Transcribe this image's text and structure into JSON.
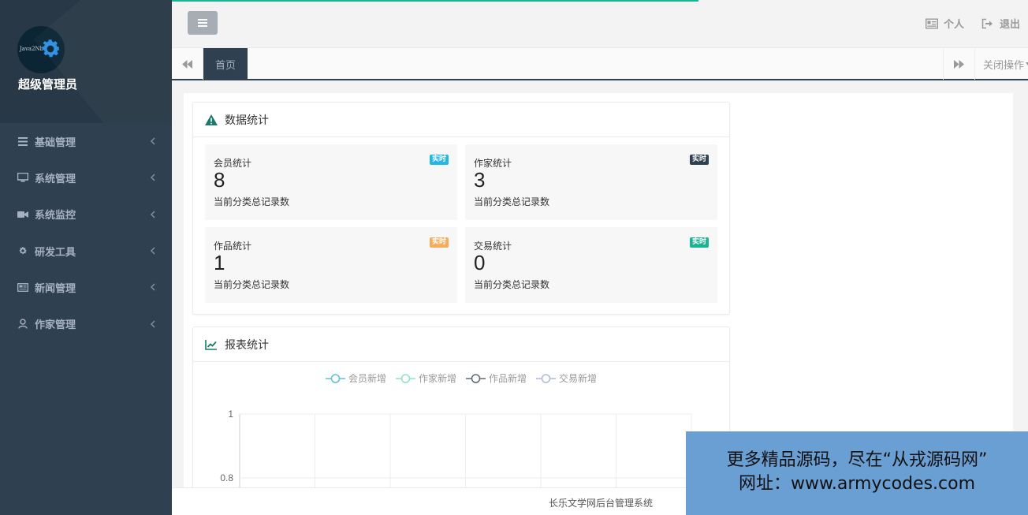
{
  "sidebar": {
    "avatar_text": "Java2Nb",
    "user_name": "超级管理员",
    "items": [
      {
        "label": "基础管理",
        "icon": "list-icon"
      },
      {
        "label": "系统管理",
        "icon": "monitor-icon"
      },
      {
        "label": "系统监控",
        "icon": "video-camera-icon"
      },
      {
        "label": "研发工具",
        "icon": "gear-icon"
      },
      {
        "label": "新闻管理",
        "icon": "newspaper-icon"
      },
      {
        "label": "作家管理",
        "icon": "user-icon"
      }
    ]
  },
  "header": {
    "personal_label": "个人",
    "logout_label": "退出"
  },
  "tabs": {
    "home_label": "首页",
    "close_ops_label": "关闭操作"
  },
  "stats_panel": {
    "title": "数据统计",
    "cards": [
      {
        "title": "会员统计",
        "badge": "实时",
        "badge_color": "#23b7e5",
        "value": "8",
        "desc": "当前分类总记录数"
      },
      {
        "title": "作家统计",
        "badge": "实时",
        "badge_color": "#2f4050",
        "value": "3",
        "desc": "当前分类总记录数"
      },
      {
        "title": "作品统计",
        "badge": "实时",
        "badge_color": "#f8ac59",
        "value": "1",
        "desc": "当前分类总记录数"
      },
      {
        "title": "交易统计",
        "badge": "实时",
        "badge_color": "#1ab394",
        "value": "0",
        "desc": "当前分类总记录数"
      }
    ]
  },
  "report_panel": {
    "title": "报表统计"
  },
  "chart_data": {
    "type": "line",
    "series": [
      {
        "name": "会员新增",
        "color": "#5bc0de",
        "values": []
      },
      {
        "name": "作家新增",
        "color": "#8fe0c8",
        "values": []
      },
      {
        "name": "作品新增",
        "color": "#5f6877",
        "values": []
      },
      {
        "name": "交易新增",
        "color": "#b4b9d6",
        "values": []
      }
    ],
    "y_ticks": [
      "1",
      "0.8"
    ],
    "ylim": [
      0,
      1
    ],
    "grid": true,
    "legend_position": "top-center"
  },
  "footer": {
    "text": "长乐文学网后台管理系统"
  },
  "watermark": {
    "line1": "更多精品源码，尽在“从戎源码网”",
    "line2": "网址：www.armycodes.com"
  },
  "colors": {
    "sidebar_bg": "#2f4050",
    "accent": "#1ab394"
  }
}
